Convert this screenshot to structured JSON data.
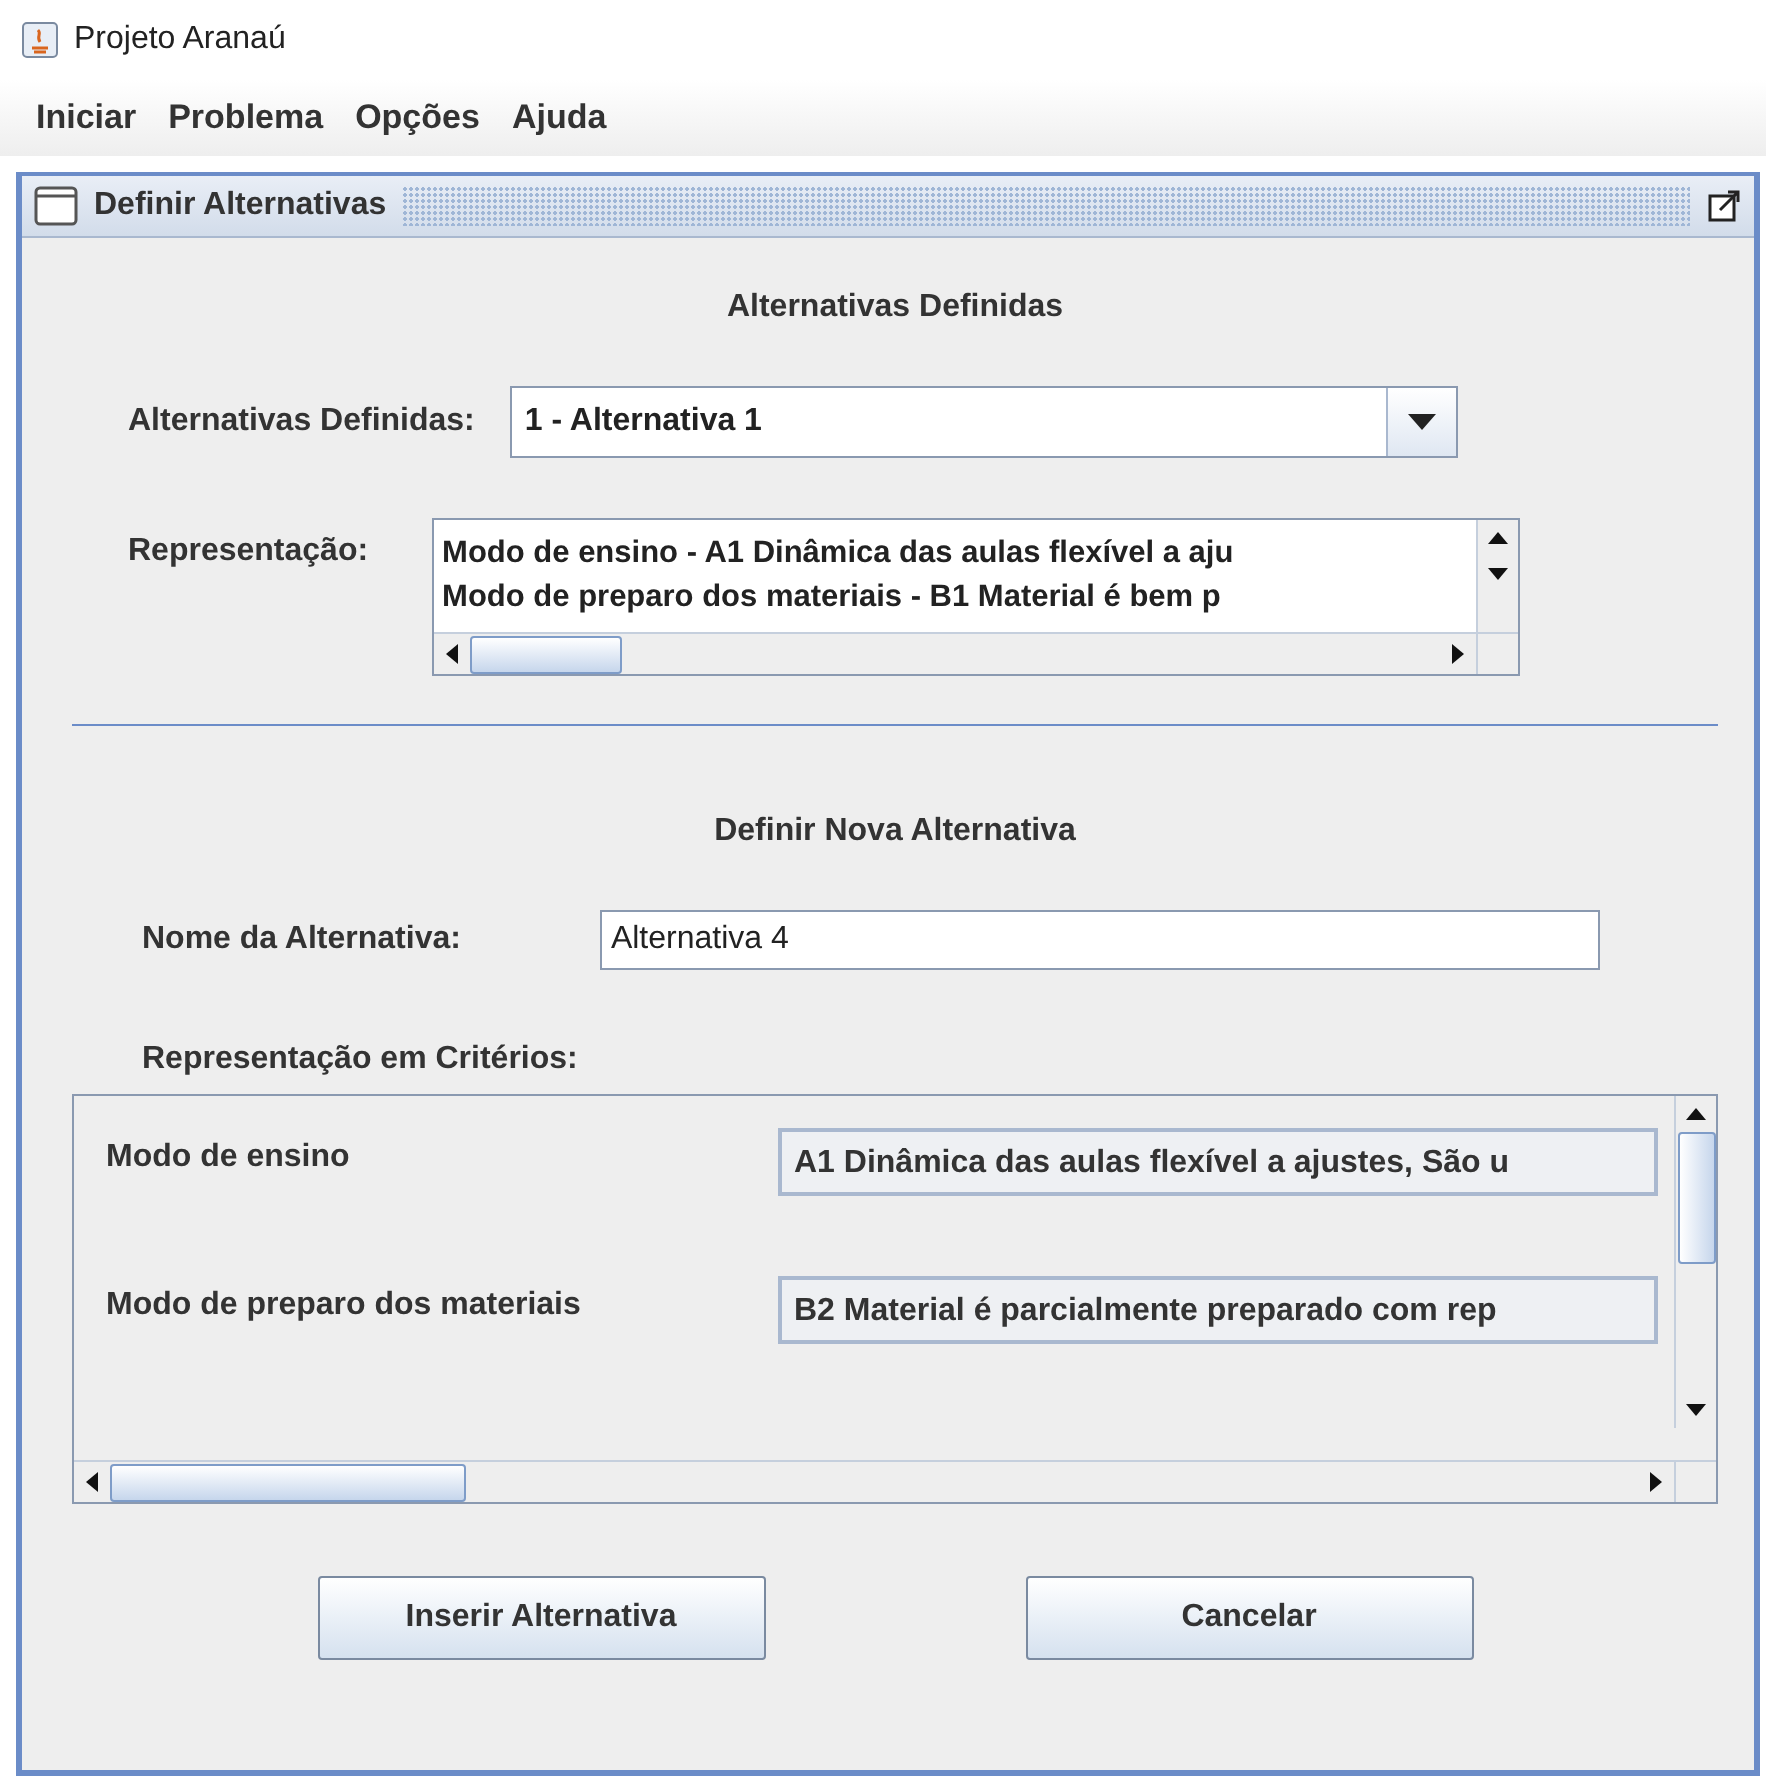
{
  "window": {
    "title": "Projeto Aranaú"
  },
  "menu": [
    "Iniciar",
    "Problema",
    "Opções",
    "Ajuda"
  ],
  "frame": {
    "title": "Definir Alternativas"
  },
  "defined": {
    "heading": "Alternativas Definidas",
    "label": "Alternativas Definidas:",
    "value": "1 - Alternativa 1",
    "representation_label": "Representação:",
    "representation_lines": [
      "Modo de ensino - A1 Dinâmica das aulas flexível a aju",
      "Modo de preparo dos materiais  - B1 Material é bem p"
    ]
  },
  "new": {
    "heading": "Definir Nova Alternativa",
    "name_label": "Nome da Alternativa:",
    "name_value": "Alternativa 4",
    "criteria_label": "Representação em Critérios:",
    "criteria": [
      {
        "name": "Modo de ensino",
        "value": "A1 Dinâmica das aulas flexível a ajustes, São u"
      },
      {
        "name": "Modo de preparo dos materiais",
        "value": "B2 Material é parcialmente preparado com rep"
      }
    ]
  },
  "buttons": [
    "Inserir Alternativa",
    "Cancelar"
  ]
}
